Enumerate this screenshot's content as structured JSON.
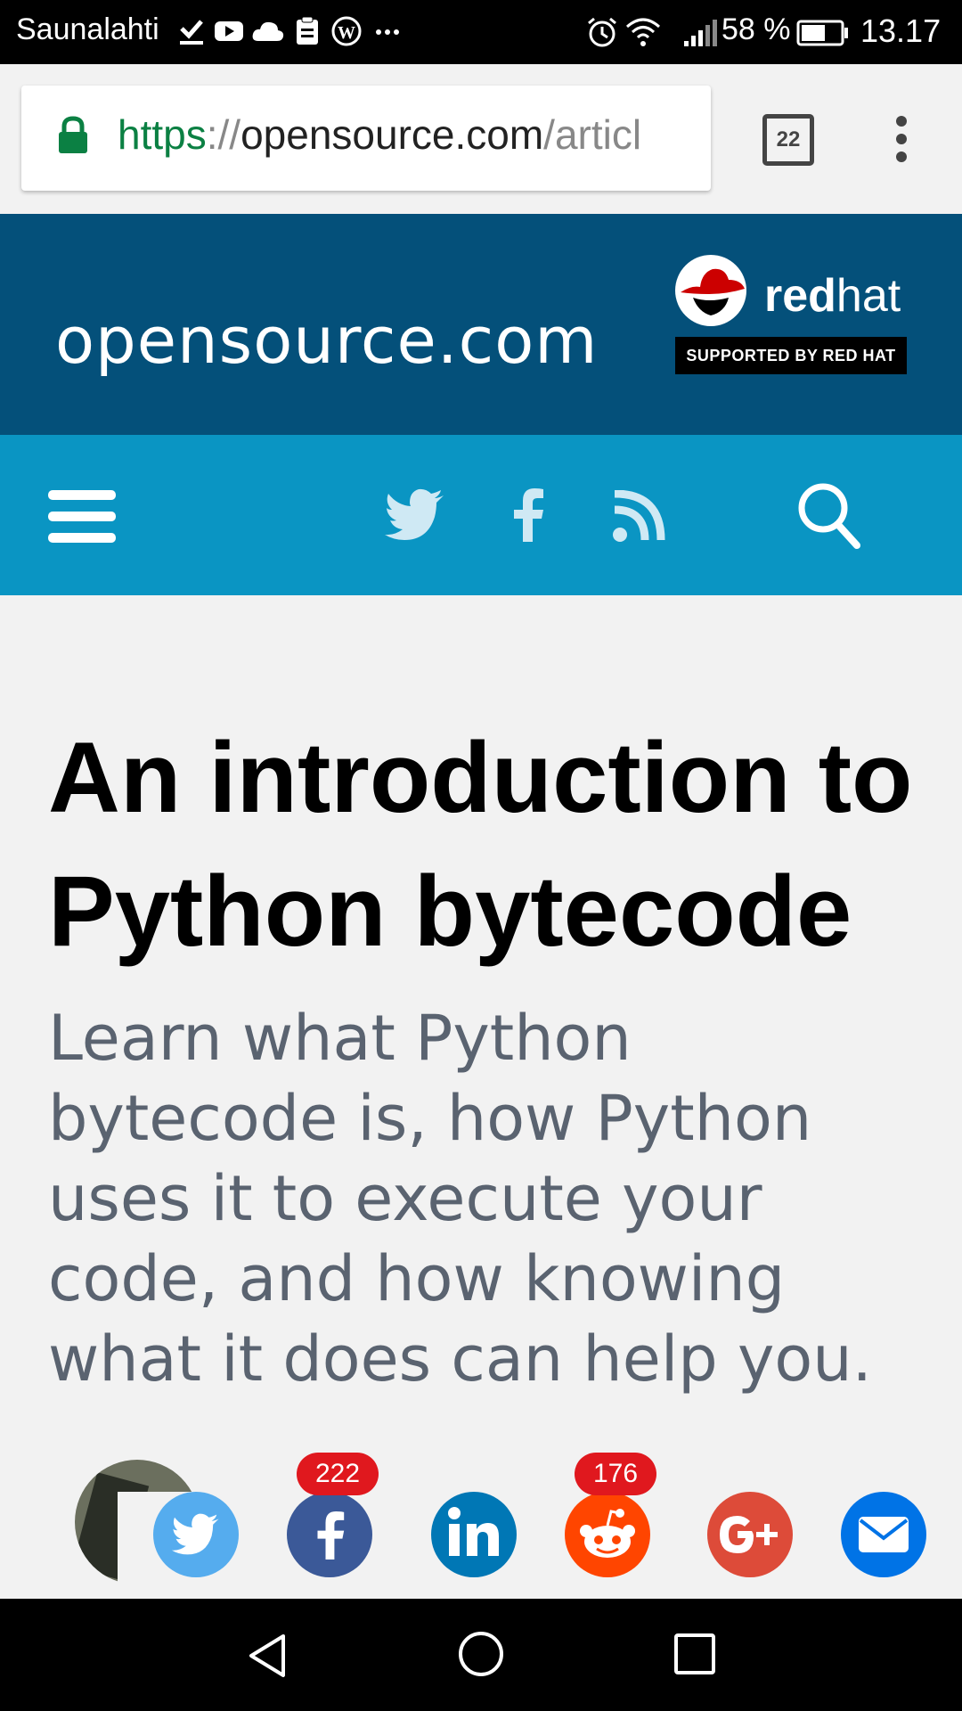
{
  "status_bar": {
    "carrier": "Saunalahti",
    "battery": "58 %",
    "time": "13.17"
  },
  "browser": {
    "url_scheme": "https",
    "url_separator": "://",
    "url_host": "opensource.com",
    "url_path": "/articl",
    "tab_count": "22"
  },
  "site_header": {
    "logo_text": "opensource.com",
    "sponsor_word_bold": "red",
    "sponsor_word_light": "hat",
    "sponsor_badge": "SUPPORTED BY RED HAT"
  },
  "article": {
    "title": "An introduction to Python bytecode",
    "lede": "Learn what Python bytecode is, how Python uses it to execute your code, and how knowing what it does can help you."
  },
  "share": {
    "facebook_count": "222",
    "reddit_count": "176"
  },
  "colors": {
    "header_bg": "#04507a",
    "nav_bg": "#0a95c3",
    "twitter": "#55acee",
    "facebook": "#3b5998",
    "linkedin": "#0077b5",
    "reddit": "#ff4500",
    "google_plus": "#dd4b39",
    "email": "#0073e6"
  }
}
